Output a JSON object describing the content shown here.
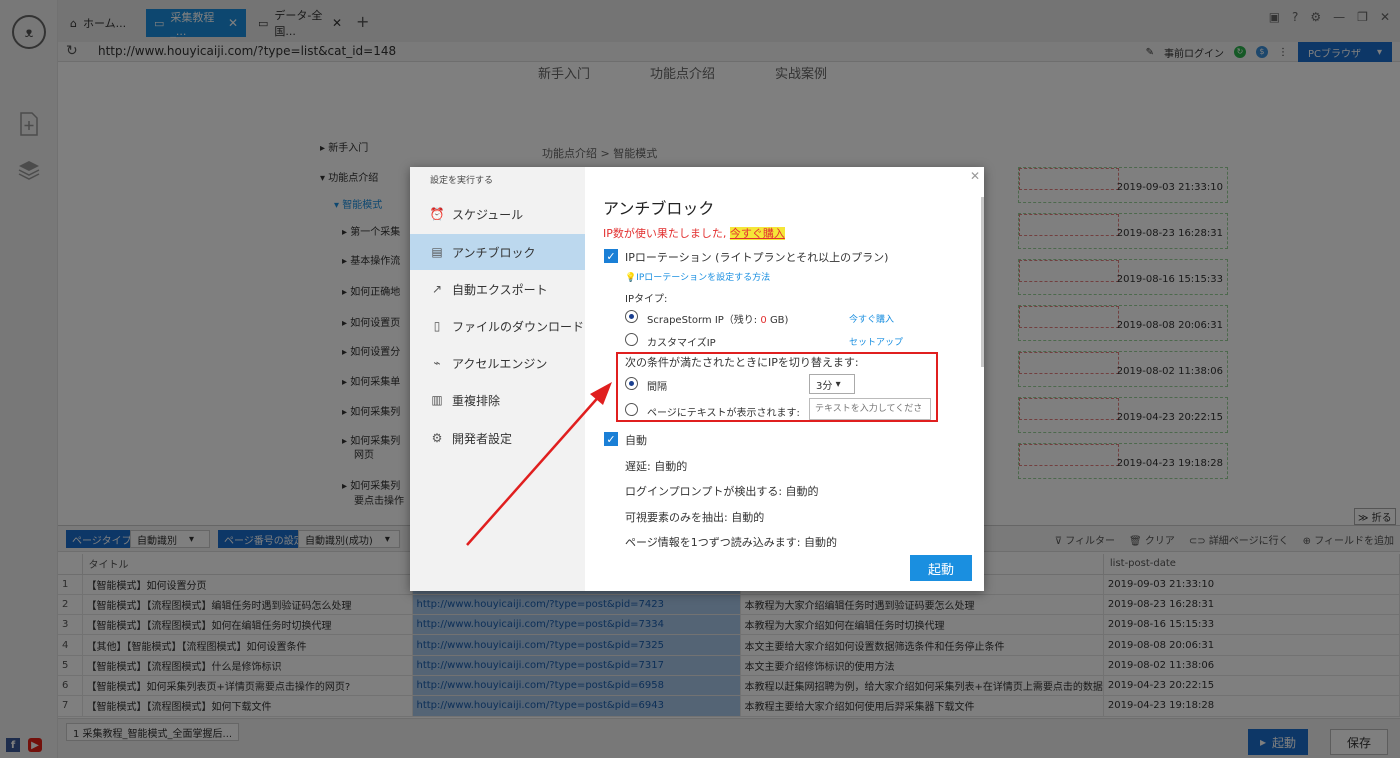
{
  "app": {
    "logo_text": "ᴥ"
  },
  "tabs": [
    {
      "label": "ホーム..."
    },
    {
      "label": "采集教程_..."
    },
    {
      "label": "データ-全国..."
    }
  ],
  "address": {
    "url": "http://www.houyicaiji.com/?type=list&cat_id=148",
    "pre_login": "事前ログイン",
    "pc_browser": "PCブラウザ",
    "badge_green": "↻",
    "badge_blue": "$"
  },
  "page_nav": [
    "新手入门",
    "功能点介绍",
    "实战案例"
  ],
  "tree": [
    "新手入门",
    "功能点介绍",
    "智能模式",
    "第一个采集",
    "基本操作流",
    "如何正确地",
    "如何设置页",
    "如何设置分",
    "如何采集单",
    "如何采集列",
    "如何采集列",
    "网页",
    "如何采集列",
    "要点击操作"
  ],
  "breadcrumb": "功能点介绍 > 智能模式",
  "right_dates": [
    "2019-09-03 21:33:10",
    "2019-08-23 16:28:31",
    "2019-08-16 15:15:33",
    "2019-08-08 20:06:31",
    "2019-08-02 11:38:06",
    "2019-04-23 20:22:15",
    "2019-04-23 19:18:28"
  ],
  "collapse_label": "折る",
  "panel": {
    "page_type_label": "ページタイプ",
    "page_type_value": "自動識別",
    "page_num_label": "ページ番号の設定",
    "page_num_value": "自動識別(成功)",
    "tools": [
      "フィルター",
      "クリア",
      "詳細ページに行く",
      "フィールドを追加"
    ],
    "columns": [
      "",
      "タイトル",
      "",
      "",
      "list-post-date"
    ],
    "rows": [
      {
        "n": "1",
        "title": "【智能模式】如何设置分页",
        "url": "",
        "desc": "",
        "date": "2019-09-03 21:33:10"
      },
      {
        "n": "2",
        "title": "【智能模式】【流程图模式】编辑任务时遇到验证码怎么处理",
        "url": "http://www.houyicaiji.com/?type=post&pid=7423",
        "desc": "本教程为大家介绍编辑任务时遇到验证码要怎么处理",
        "date": "2019-08-23 16:28:31"
      },
      {
        "n": "3",
        "title": "【智能模式】【流程图模式】如何在编辑任务时切换代理",
        "url": "http://www.houyicaiji.com/?type=post&pid=7334",
        "desc": "本教程为大家介绍如何在编辑任务时切换代理",
        "date": "2019-08-16 15:15:33"
      },
      {
        "n": "4",
        "title": "【其他】【智能模式】【流程图模式】如何设置条件",
        "url": "http://www.houyicaiji.com/?type=post&pid=7325",
        "desc": "本文主要给大家介绍如何设置数据筛选条件和任务停止条件",
        "date": "2019-08-08 20:06:31"
      },
      {
        "n": "5",
        "title": "【智能模式】【流程图模式】什么是修饰标识",
        "url": "http://www.houyicaiji.com/?type=post&pid=7317",
        "desc": "本文主要介绍修饰标识的使用方法",
        "date": "2019-08-02 11:38:06"
      },
      {
        "n": "6",
        "title": "【智能模式】如何采集列表页+详情页需要点击操作的网页?",
        "url": "http://www.houyicaiji.com/?type=post&pid=6958",
        "desc": "本教程以赶集网招聘为例，给大家介绍如何采集列表+在详情页上需要点击的数据",
        "date": "2019-04-23 20:22:15"
      },
      {
        "n": "7",
        "title": "【智能模式】【流程图模式】如何下载文件",
        "url": "http://www.houyicaiji.com/?type=post&pid=6943",
        "desc": "本教程主要给大家介绍如何使用后羿采集器下载文件",
        "date": "2019-04-23 19:18:28"
      }
    ]
  },
  "status": {
    "task": "1 采集教程_智能模式_全面掌握后...",
    "run_label": "起動",
    "save_label": "保存"
  },
  "dialog": {
    "title": "設定を実行する",
    "nav": [
      "スケジュール",
      "アンチブロック",
      "自動エクスポート",
      "ファイルのダウンロード",
      "アクセルエンジン",
      "重複排除",
      "開発者設定"
    ],
    "heading": "アンチブロック",
    "warn_text": "IP数が使い果たしました,",
    "warn_buy": "今すぐ購入",
    "ip_rotation_label": "IPローテーション (ライトプランとそれ以上のプラン)",
    "ip_rotation_help": "IPローテーションを設定する方法",
    "ip_type_label": "IPタイプ:",
    "scrapestorm_ip_label": "ScrapeStorm IP（残り:",
    "scrapestorm_ip_remaining": "0",
    "scrapestorm_ip_unit": "GB)",
    "buy_now": "今すぐ購入",
    "custom_ip_label": "カスタマイズIP",
    "setup_link": "セットアップ",
    "switch_condition_label": "次の条件が満たされたときにIPを切り替えます:",
    "interval_label": "間隔",
    "interval_value": "3分",
    "page_text_label": "ページにテキストが表示されます:",
    "page_text_placeholder": "テキストを入力してくださ",
    "auto_label": "自動",
    "delay_text": "遅延: 自動的",
    "login_prompt_text": "ログインプロンプトが検出する: 自動的",
    "visible_only_text": "可視要素のみを抽出: 自動的",
    "page_info_text": "ページ情報を1つずつ読み込みます: 自動的",
    "start_label": "起動"
  },
  "colors": {
    "accent": "#1a8fe0",
    "annotation_red": "#e01f1f",
    "warn_red": "#e23030",
    "highlight_yellow": "#f5e638"
  }
}
